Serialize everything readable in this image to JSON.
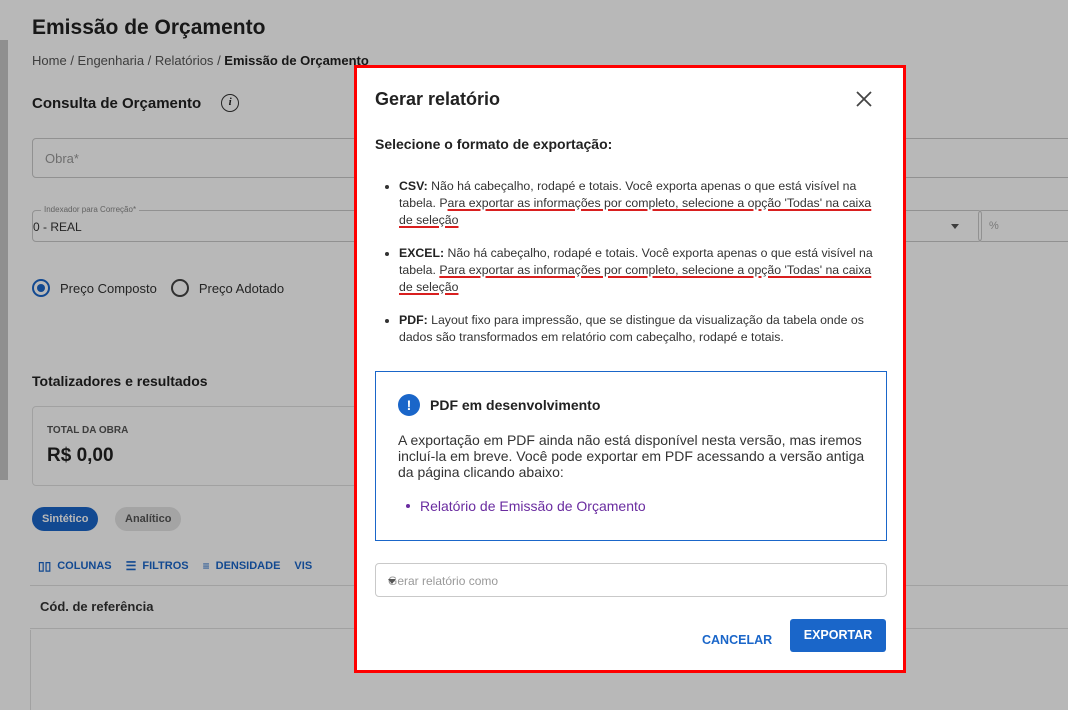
{
  "page": {
    "title": "Emissão de Orçamento",
    "breadcrumb": [
      {
        "label": "Home"
      },
      {
        "label": "Engenharia"
      },
      {
        "label": "Relatórios"
      },
      {
        "label": "Emissão de Orçamento",
        "current": true
      }
    ],
    "breadcrumb_separator": "/",
    "section_title": "Consulta de Orçamento",
    "info_icon": "i",
    "obra_placeholder": "Obra*",
    "indexador_label": "Indexador para Correção*",
    "indexador_value": "0 - REAL",
    "percent_placeholder": "%",
    "price_options": [
      "Preço Composto",
      "Preço Adotado"
    ],
    "price_selected": "Preço Composto",
    "totals_title": "Totalizadores e resultados",
    "total_label": "TOTAL DA OBRA",
    "total_value": "R$ 0,00",
    "view_chips": [
      "Sintético",
      "Analítico"
    ],
    "view_selected": "Sintético",
    "toolbar": {
      "columns": "COLUNAS",
      "filters": "FILTROS",
      "density": "DENSIDADE",
      "view_partial": "VIS"
    },
    "grid_header": "Cód. de referência"
  },
  "modal": {
    "title": "Gerar relatório",
    "subtitle": "Selecione o formato de exportação:",
    "formats": [
      {
        "name": "CSV:",
        "text": "Não há cabeçalho, rodapé e totais. Você exporta apenas o que está visível na tabela. P",
        "highlight": "ara exportar as informações por completo, selecione a opção 'Todas' na caixa de seleção"
      },
      {
        "name": "EXCEL:",
        "text": "Não há cabeçalho, rodapé e totais. Você exporta apenas o que está visível na tabela. ",
        "highlight": "Para exportar as informações por completo, selecione a opção 'Todas' na caixa de seleção"
      },
      {
        "name": "PDF:",
        "text": "Layout fixo para impressão, que se distingue da visualização da tabela onde os dados são transformados em relatório com cabeçalho, rodapé e totais.",
        "highlight": ""
      }
    ],
    "notice": {
      "icon": "!",
      "title": "PDF em desenvolvimento",
      "text": "A exportação em PDF ainda não está disponível nesta versão, mas iremos incluí-la em breve. Você pode exportar em PDF acessando a versão antiga da página clicando abaixo:",
      "link": "Relatório de Emissão de Orçamento"
    },
    "select_placeholder": "Gerar relatório como",
    "cancel_label": "CANCELAR",
    "export_label": "EXPORTAR"
  },
  "colors": {
    "accent": "#1a66c9",
    "highlight_border": "#ff0000",
    "annotation_underline": "#d91f1f",
    "link": "#6a2ca0"
  }
}
